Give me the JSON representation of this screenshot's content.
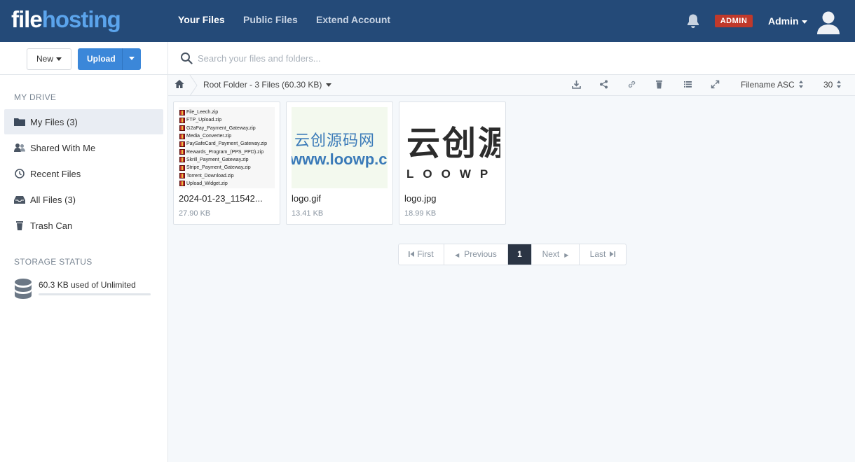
{
  "header": {
    "logo_part1": "file",
    "logo_part2": "hosting",
    "nav": [
      {
        "label": "Your Files",
        "active": true
      },
      {
        "label": "Public Files",
        "active": false
      },
      {
        "label": "Extend Account",
        "active": false
      }
    ],
    "badge": "ADMIN",
    "user": "Admin",
    "colors": {
      "topbar": "#244a78",
      "logo_accent": "#5ba4ec",
      "badge": "#c0392b"
    }
  },
  "sidebar": {
    "new_label": "New",
    "upload_label": "Upload",
    "drive_title": "MY DRIVE",
    "items": [
      {
        "label": "My Files (3)",
        "icon": "folder-icon",
        "active": true
      },
      {
        "label": "Shared With Me",
        "icon": "users-icon",
        "active": false
      },
      {
        "label": "Recent Files",
        "icon": "clock-icon",
        "active": false
      },
      {
        "label": "All Files (3)",
        "icon": "inbox-icon",
        "active": false
      },
      {
        "label": "Trash Can",
        "icon": "trash-icon",
        "active": false
      }
    ],
    "storage_title": "STORAGE STATUS",
    "storage_text": "60.3 KB used of Unlimited",
    "storage_fill_fraction": 0
  },
  "search": {
    "placeholder": "Search your files and folders..."
  },
  "toolbar": {
    "breadcrumb": "Root Folder - 3 Files (60.30 KB)",
    "tools": [
      "download-icon",
      "share-icon",
      "link-icon",
      "trash-icon",
      "list-view-icon",
      "fullscreen-icon"
    ],
    "sort": "Filename ASC",
    "per_page": "30"
  },
  "files": [
    {
      "name": "2024-01-23_11542...",
      "size": "27.90 KB",
      "thumb_lines": [
        "File_Leech.zip",
        "FTP_Upload.zip",
        "G2aPay_Payment_Gateway.zip",
        "Media_Converter.zip",
        "PaySafeCard_Payment_Gateway.zip",
        "Rewards_Program_(PPS_PPD).zip",
        "Skrill_Payment_Gateway.zip",
        "Stripe_Payment_Gateway.zip",
        "Torrent_Download.zip",
        "Upload_Widget.zip"
      ]
    },
    {
      "name": "logo.gif",
      "size": "13.41 KB",
      "thumb_line1": "云创源码网",
      "thumb_line2": "www.loowp.com"
    },
    {
      "name": "logo.jpg",
      "size": "18.99 KB",
      "thumb_line1": "云创源",
      "thumb_line2": "LOOWP"
    }
  ],
  "pagination": {
    "first": "First",
    "previous": "Previous",
    "current": "1",
    "next": "Next",
    "last": "Last"
  }
}
